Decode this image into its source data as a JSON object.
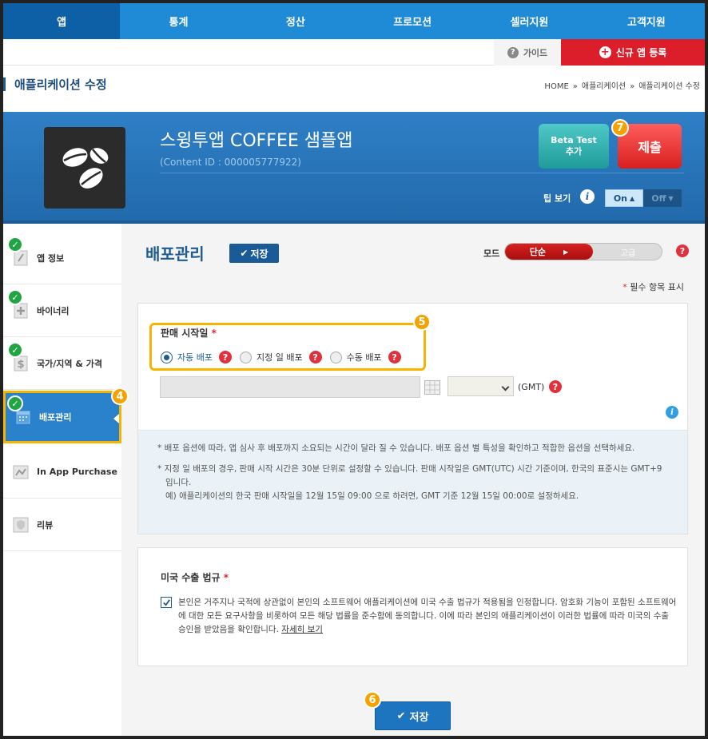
{
  "nav": {
    "items": [
      {
        "label": "앱",
        "active": true
      },
      {
        "label": "통계",
        "active": false
      },
      {
        "label": "정산",
        "active": false
      },
      {
        "label": "프로모션",
        "active": false
      },
      {
        "label": "셀러지원",
        "active": false
      },
      {
        "label": "고객지원",
        "active": false
      }
    ]
  },
  "util": {
    "guide_label": "가이드",
    "new_app_label": "신규 앱 등록"
  },
  "page": {
    "title": "애플리케이션 수정",
    "breadcrumb": [
      "HOME",
      "애플리케이션",
      "애플리케이션 수정"
    ],
    "breadcrumb_sep": "»"
  },
  "app": {
    "name": "스윙투앱 COFFEE 샘플앱",
    "content_id": "(Content ID : 000005777922)",
    "beta_line1": "Beta Test",
    "beta_line2": "추가",
    "submit_label": "제출",
    "tip_label": "팁 보기",
    "tip_on": "On",
    "tip_off": "Off"
  },
  "badges": {
    "four": "4",
    "five": "5",
    "six": "6",
    "seven": "7"
  },
  "sidebar": {
    "items": [
      {
        "label": "앱 정보",
        "done": true,
        "active": false
      },
      {
        "label": "바이너리",
        "done": true,
        "active": false
      },
      {
        "label": "국가/지역 & 가격",
        "done": true,
        "active": false
      },
      {
        "label": "배포관리",
        "done": true,
        "active": true
      },
      {
        "label": "In App Purchase",
        "done": false,
        "active": false
      },
      {
        "label": "리뷰",
        "done": false,
        "active": false
      }
    ]
  },
  "main": {
    "section_title": "배포관리",
    "save_label": "저장",
    "mode_label": "모드",
    "mode_simple": "단순",
    "mode_advanced": "고급",
    "required_note": "필수 항목 표시",
    "required_star": "*",
    "sale_start": {
      "label": "판매 시작일",
      "options": [
        {
          "label": "자동 배포",
          "checked": true
        },
        {
          "label": "지정 일 배포",
          "checked": false
        },
        {
          "label": "수동 배포",
          "checked": false
        }
      ],
      "date_value": "",
      "time_value": "",
      "gmt_label": "(GMT)"
    },
    "notes": [
      "* 배포 옵션에 따라, 앱 심사 후 배포까지 소요되는 시간이 달라 질 수 있습니다. 배포 옵션 별 특성을 확인하고 적합한 옵션을 선택하세요.",
      "* 지정 일 배포의 경우, 판매 시작 시간은 30분 단위로 설정할 수 있습니다. 판매 시작일은 GMT(UTC) 시간 기준이며, 한국의 표준시는 GMT+9 입니다.",
      "예) 애플리케이션의 한국 판매 시작일을 12월 15일 09:00 으로 하려면, GMT 기준 12월 15일 00:00로 설정하세요."
    ],
    "export": {
      "title": "미국 수출 법규",
      "checked": true,
      "text": "본인은 거주지나 국적에 상관없이 본인의 소프트웨어 애플리케이션에 미국 수출 법규가 적용됨을 인정합니다. 암호화 기능이 포함된 소프트웨어에 대한 모든 요구사항을 비롯하여 모든 해당 법률을 준수함에 동의합니다. 이에 따라 본인의 애플리케이션이 이러한 법률에 따라 미국의 수출 승인을 받았음을 확인합니다.",
      "detail_link": "자세히 보기"
    },
    "save_bottom_label": "저장"
  },
  "colors": {
    "nav_bg": "#1f8ad6",
    "nav_active": "#0d5fa6",
    "banner": "#2c78bd",
    "submit": "#e02828",
    "beta": "#2fb3b2",
    "accent_badge": "#f5a200",
    "check_green": "#21a444"
  },
  "icons": {
    "help": "question-icon",
    "plus": "plus-circle-icon",
    "check": "check-icon",
    "calendar": "calendar-icon",
    "info": "info-icon"
  }
}
